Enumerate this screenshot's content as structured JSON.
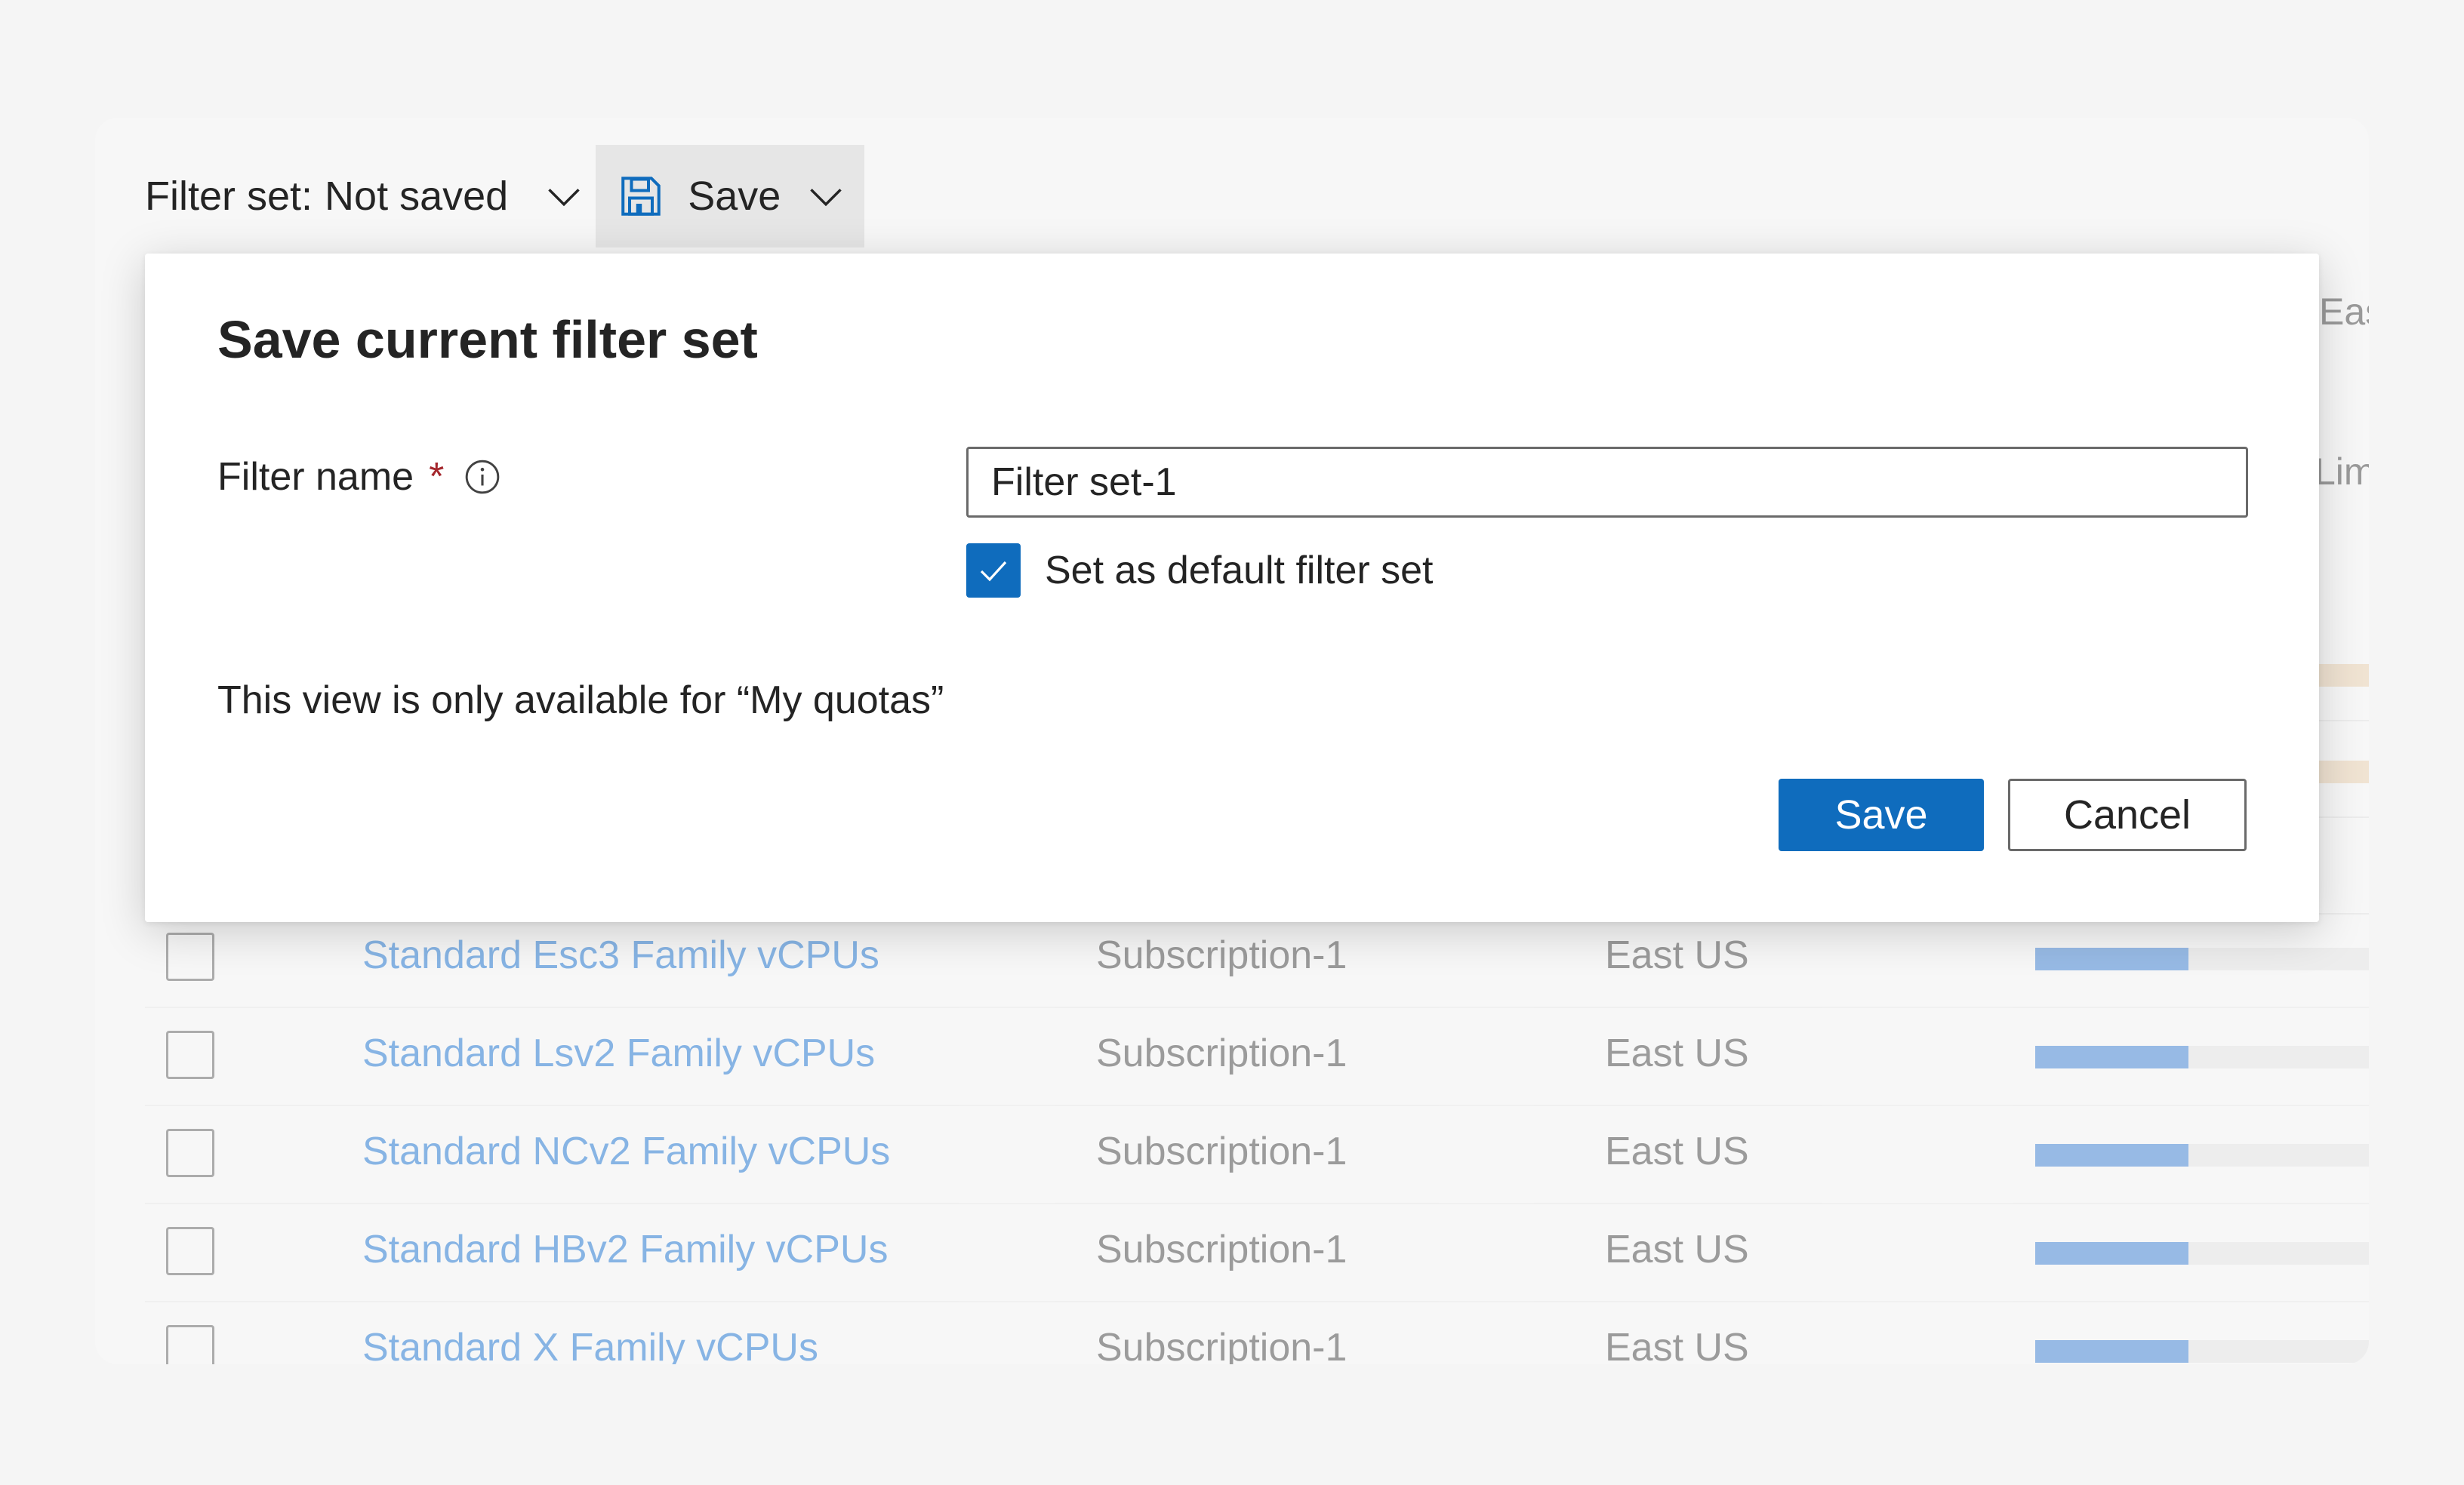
{
  "toolbar": {
    "filter_set_label": "Filter set:",
    "filter_set_value": "Not saved",
    "save_label": "Save"
  },
  "dialog": {
    "title": "Save current filter set",
    "filter_name_label": "Filter name",
    "required_mark": "*",
    "filter_name_value": "Filter set-1",
    "default_checkbox_label": "Set as default filter set",
    "default_checked": true,
    "note": "This view is only available for “My quotas”",
    "save_button": "Save",
    "cancel_button": "Cancel"
  },
  "background": {
    "peek_region": "Eas",
    "peek_column": "Lim"
  },
  "table": {
    "rows": [
      {
        "name": "Standard Esc3 Family vCPUs",
        "subscription": "Subscription-1",
        "region": "East US",
        "usage": 0.46
      },
      {
        "name": "Standard Lsv2 Family vCPUs",
        "subscription": "Subscription-1",
        "region": "East US",
        "usage": 0.46
      },
      {
        "name": "Standard NCv2 Family vCPUs",
        "subscription": "Subscription-1",
        "region": "East US",
        "usage": 0.46
      },
      {
        "name": "Standard HBv2 Family vCPUs",
        "subscription": "Subscription-1",
        "region": "East US",
        "usage": 0.46
      },
      {
        "name": "Standard X Family vCPUs",
        "subscription": "Subscription-1",
        "region": "East US",
        "usage": 0.46
      }
    ]
  },
  "colors": {
    "accent": "#0f6cbd",
    "link": "#2c7fd6",
    "required": "#a4262c"
  },
  "icons": {
    "save": "floppy-disk-icon",
    "dropdown": "chevron-down-icon",
    "info": "info-icon",
    "check": "checkmark-icon"
  }
}
